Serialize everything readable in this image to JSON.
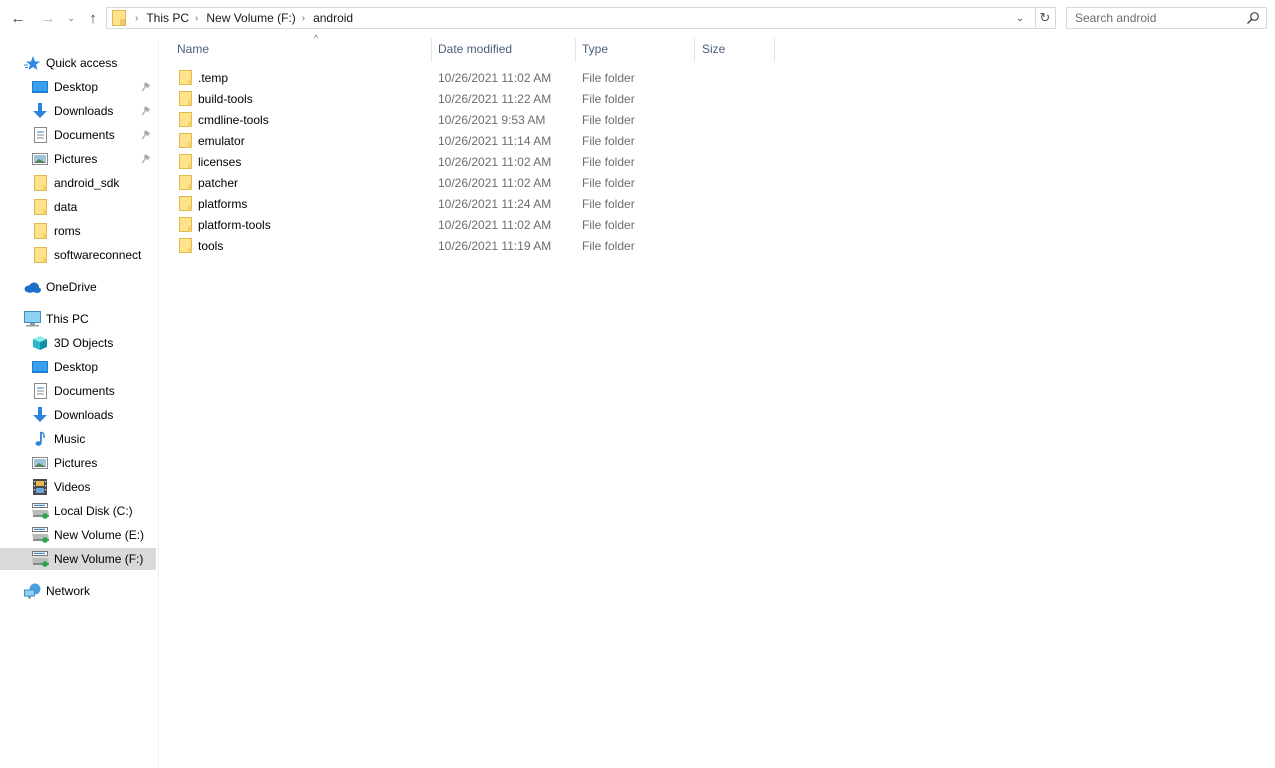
{
  "navigation": {
    "back_icon": "arrow-left-icon",
    "forward_icon": "arrow-right-icon",
    "recent_icon": "chevron-down-icon",
    "up_icon": "arrow-up-icon",
    "back_glyph": "←",
    "forward_glyph": "→",
    "recent_glyph": "⌄",
    "up_glyph": "↑"
  },
  "address_bar": {
    "breadcrumbs": [
      "This PC",
      "New Volume (F:)",
      "android"
    ],
    "separator": "›",
    "dropdown_glyph": "⌄",
    "refresh_glyph": "↻"
  },
  "search": {
    "placeholder": "Search android",
    "value": ""
  },
  "sidebar": {
    "quick_access": {
      "label": "Quick access",
      "icon": "star-icon",
      "items": [
        {
          "label": "Desktop",
          "icon": "desktop-icon",
          "pinned": true
        },
        {
          "label": "Downloads",
          "icon": "download-icon",
          "pinned": true
        },
        {
          "label": "Documents",
          "icon": "document-icon",
          "pinned": true
        },
        {
          "label": "Pictures",
          "icon": "pictures-icon",
          "pinned": true
        },
        {
          "label": "android_sdk",
          "icon": "folder-icon",
          "pinned": false
        },
        {
          "label": "data",
          "icon": "folder-icon",
          "pinned": false
        },
        {
          "label": "roms",
          "icon": "folder-icon",
          "pinned": false
        },
        {
          "label": "softwareconnect",
          "icon": "folder-icon",
          "pinned": false
        }
      ]
    },
    "onedrive": {
      "label": "OneDrive",
      "icon": "cloud-icon"
    },
    "this_pc": {
      "label": "This PC",
      "icon": "computer-icon",
      "items": [
        {
          "label": "3D Objects",
          "icon": "cube-icon"
        },
        {
          "label": "Desktop",
          "icon": "desktop-icon"
        },
        {
          "label": "Documents",
          "icon": "document-icon"
        },
        {
          "label": "Downloads",
          "icon": "download-icon"
        },
        {
          "label": "Music",
          "icon": "music-icon"
        },
        {
          "label": "Pictures",
          "icon": "pictures-icon"
        },
        {
          "label": "Videos",
          "icon": "video-icon"
        },
        {
          "label": "Local Disk (C:)",
          "icon": "drive-icon"
        },
        {
          "label": "New Volume (E:)",
          "icon": "drive-icon"
        },
        {
          "label": "New Volume (F:)",
          "icon": "drive-icon",
          "selected": true
        }
      ]
    },
    "network": {
      "label": "Network",
      "icon": "network-icon"
    }
  },
  "file_list": {
    "columns": {
      "name": "Name",
      "date_modified": "Date modified",
      "type": "Type",
      "size": "Size"
    },
    "sort_glyph": "^",
    "rows": [
      {
        "name": ".temp",
        "date_modified": "10/26/2021 11:02 AM",
        "type": "File folder",
        "size": ""
      },
      {
        "name": "build-tools",
        "date_modified": "10/26/2021 11:22 AM",
        "type": "File folder",
        "size": ""
      },
      {
        "name": "cmdline-tools",
        "date_modified": "10/26/2021 9:53 AM",
        "type": "File folder",
        "size": ""
      },
      {
        "name": "emulator",
        "date_modified": "10/26/2021 11:14 AM",
        "type": "File folder",
        "size": ""
      },
      {
        "name": "licenses",
        "date_modified": "10/26/2021 11:02 AM",
        "type": "File folder",
        "size": ""
      },
      {
        "name": "patcher",
        "date_modified": "10/26/2021 11:02 AM",
        "type": "File folder",
        "size": ""
      },
      {
        "name": "platforms",
        "date_modified": "10/26/2021 11:24 AM",
        "type": "File folder",
        "size": ""
      },
      {
        "name": "platform-tools",
        "date_modified": "10/26/2021 11:02 AM",
        "type": "File folder",
        "size": ""
      },
      {
        "name": "tools",
        "date_modified": "10/26/2021 11:19 AM",
        "type": "File folder",
        "size": ""
      }
    ]
  },
  "colors": {
    "folder_fill": "#ffe28a",
    "folder_edge": "#e0b94f",
    "selection": "#d9d9d9",
    "header_text": "#4c607a",
    "secondary_text": "#6d6d6d",
    "accent_blue": "#1e88e5"
  }
}
